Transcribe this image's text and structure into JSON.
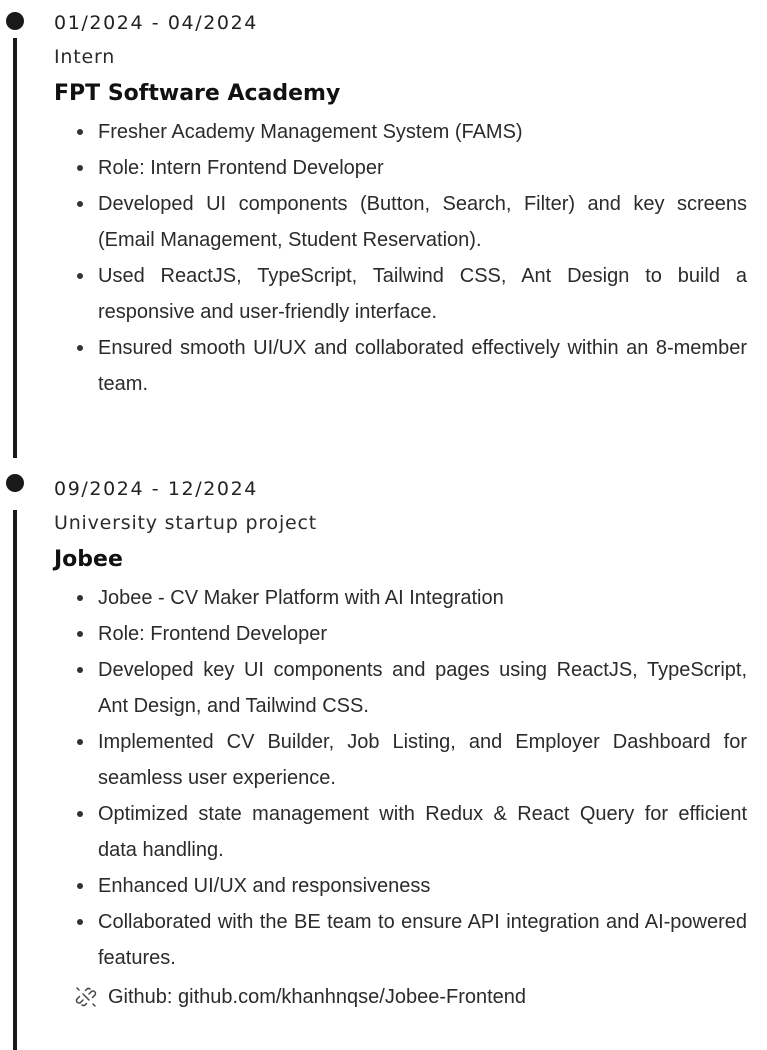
{
  "experience": [
    {
      "date": "01/2024 - 04/2024",
      "role": "Intern",
      "company": "FPT Software Academy",
      "bullets": [
        "Fresher Academy Management System (FAMS)",
        "Role: Intern Frontend Developer",
        "Developed UI components (Button, Search, Filter) and key screens (Email Management, Student Reservation).",
        "Used ReactJS, TypeScript, Tailwind CSS, Ant Design to build a responsive and user-friendly interface.",
        "Ensured smooth UI/UX and collaborated effectively within an 8-member team."
      ]
    },
    {
      "date": "09/2024 - 12/2024",
      "role": "University startup project",
      "company": "Jobee",
      "bullets": [
        "Jobee - CV Maker Platform with AI Integration",
        "Role: Frontend Developer",
        "Developed key UI components and pages using ReactJS, TypeScript, Ant Design, and Tailwind CSS.",
        "Implemented CV Builder, Job Listing, and Employer Dashboard for seamless user experience.",
        "Optimized state management with Redux & React Query for efficient data handling.",
        "Enhanced UI/UX and responsiveness",
        "Collaborated with the BE team to ensure API integration and AI-powered features."
      ],
      "link": {
        "icon": "broken-link-icon",
        "text": "Github: github.com/khanhnqse/Jobee-Frontend"
      }
    }
  ]
}
